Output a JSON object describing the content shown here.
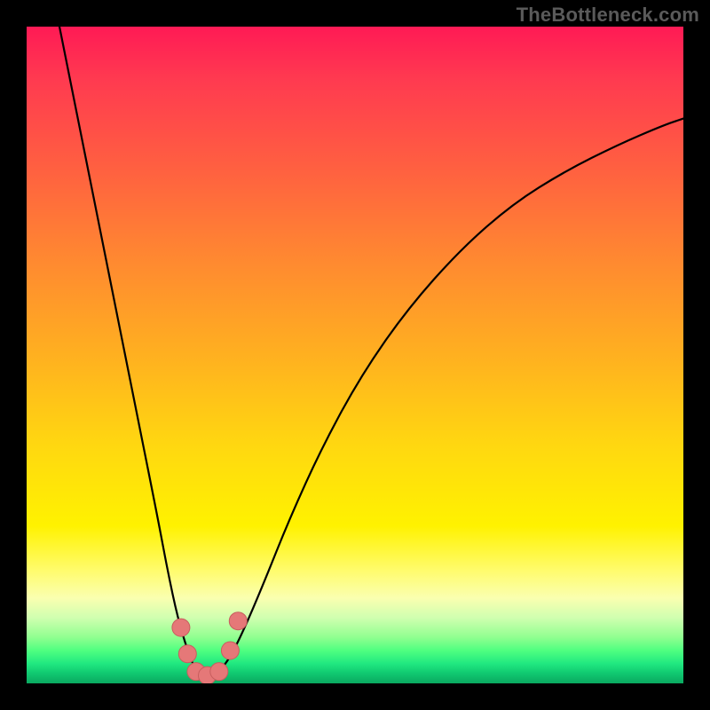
{
  "watermark": "TheBottleneck.com",
  "chart_data": {
    "type": "line",
    "title": "",
    "xlabel": "",
    "ylabel": "",
    "xlim": [
      0,
      1
    ],
    "ylim": [
      0,
      1
    ],
    "background_gradient": {
      "direction": "vertical",
      "stops": [
        {
          "pos": 0.0,
          "color": "#ff1a55"
        },
        {
          "pos": 0.5,
          "color": "#ffb020"
        },
        {
          "pos": 0.8,
          "color": "#fff200"
        },
        {
          "pos": 0.92,
          "color": "#90ff90"
        },
        {
          "pos": 1.0,
          "color": "#0aa860"
        }
      ]
    },
    "curve": {
      "description": "V-shaped bottleneck curve; left branch steep descending, right branch rising with diminishing slope",
      "x": [
        0.05,
        0.08,
        0.11,
        0.14,
        0.17,
        0.2,
        0.215,
        0.23,
        0.245,
        0.257,
        0.268,
        0.28,
        0.295,
        0.31,
        0.33,
        0.36,
        0.4,
        0.45,
        0.51,
        0.58,
        0.66,
        0.74,
        0.82,
        0.9,
        0.97,
        1.0
      ],
      "y": [
        1.0,
        0.85,
        0.7,
        0.55,
        0.4,
        0.25,
        0.17,
        0.1,
        0.05,
        0.02,
        0.01,
        0.01,
        0.02,
        0.04,
        0.08,
        0.15,
        0.25,
        0.36,
        0.47,
        0.57,
        0.66,
        0.73,
        0.78,
        0.82,
        0.85,
        0.86
      ]
    },
    "markers": {
      "description": "highlighted points near the curve minimum",
      "points": [
        {
          "x": 0.235,
          "y": 0.085
        },
        {
          "x": 0.245,
          "y": 0.045
        },
        {
          "x": 0.258,
          "y": 0.018
        },
        {
          "x": 0.275,
          "y": 0.012
        },
        {
          "x": 0.293,
          "y": 0.018
        },
        {
          "x": 0.31,
          "y": 0.05
        },
        {
          "x": 0.322,
          "y": 0.095
        }
      ],
      "color": "#e57878",
      "radius": 10
    }
  }
}
